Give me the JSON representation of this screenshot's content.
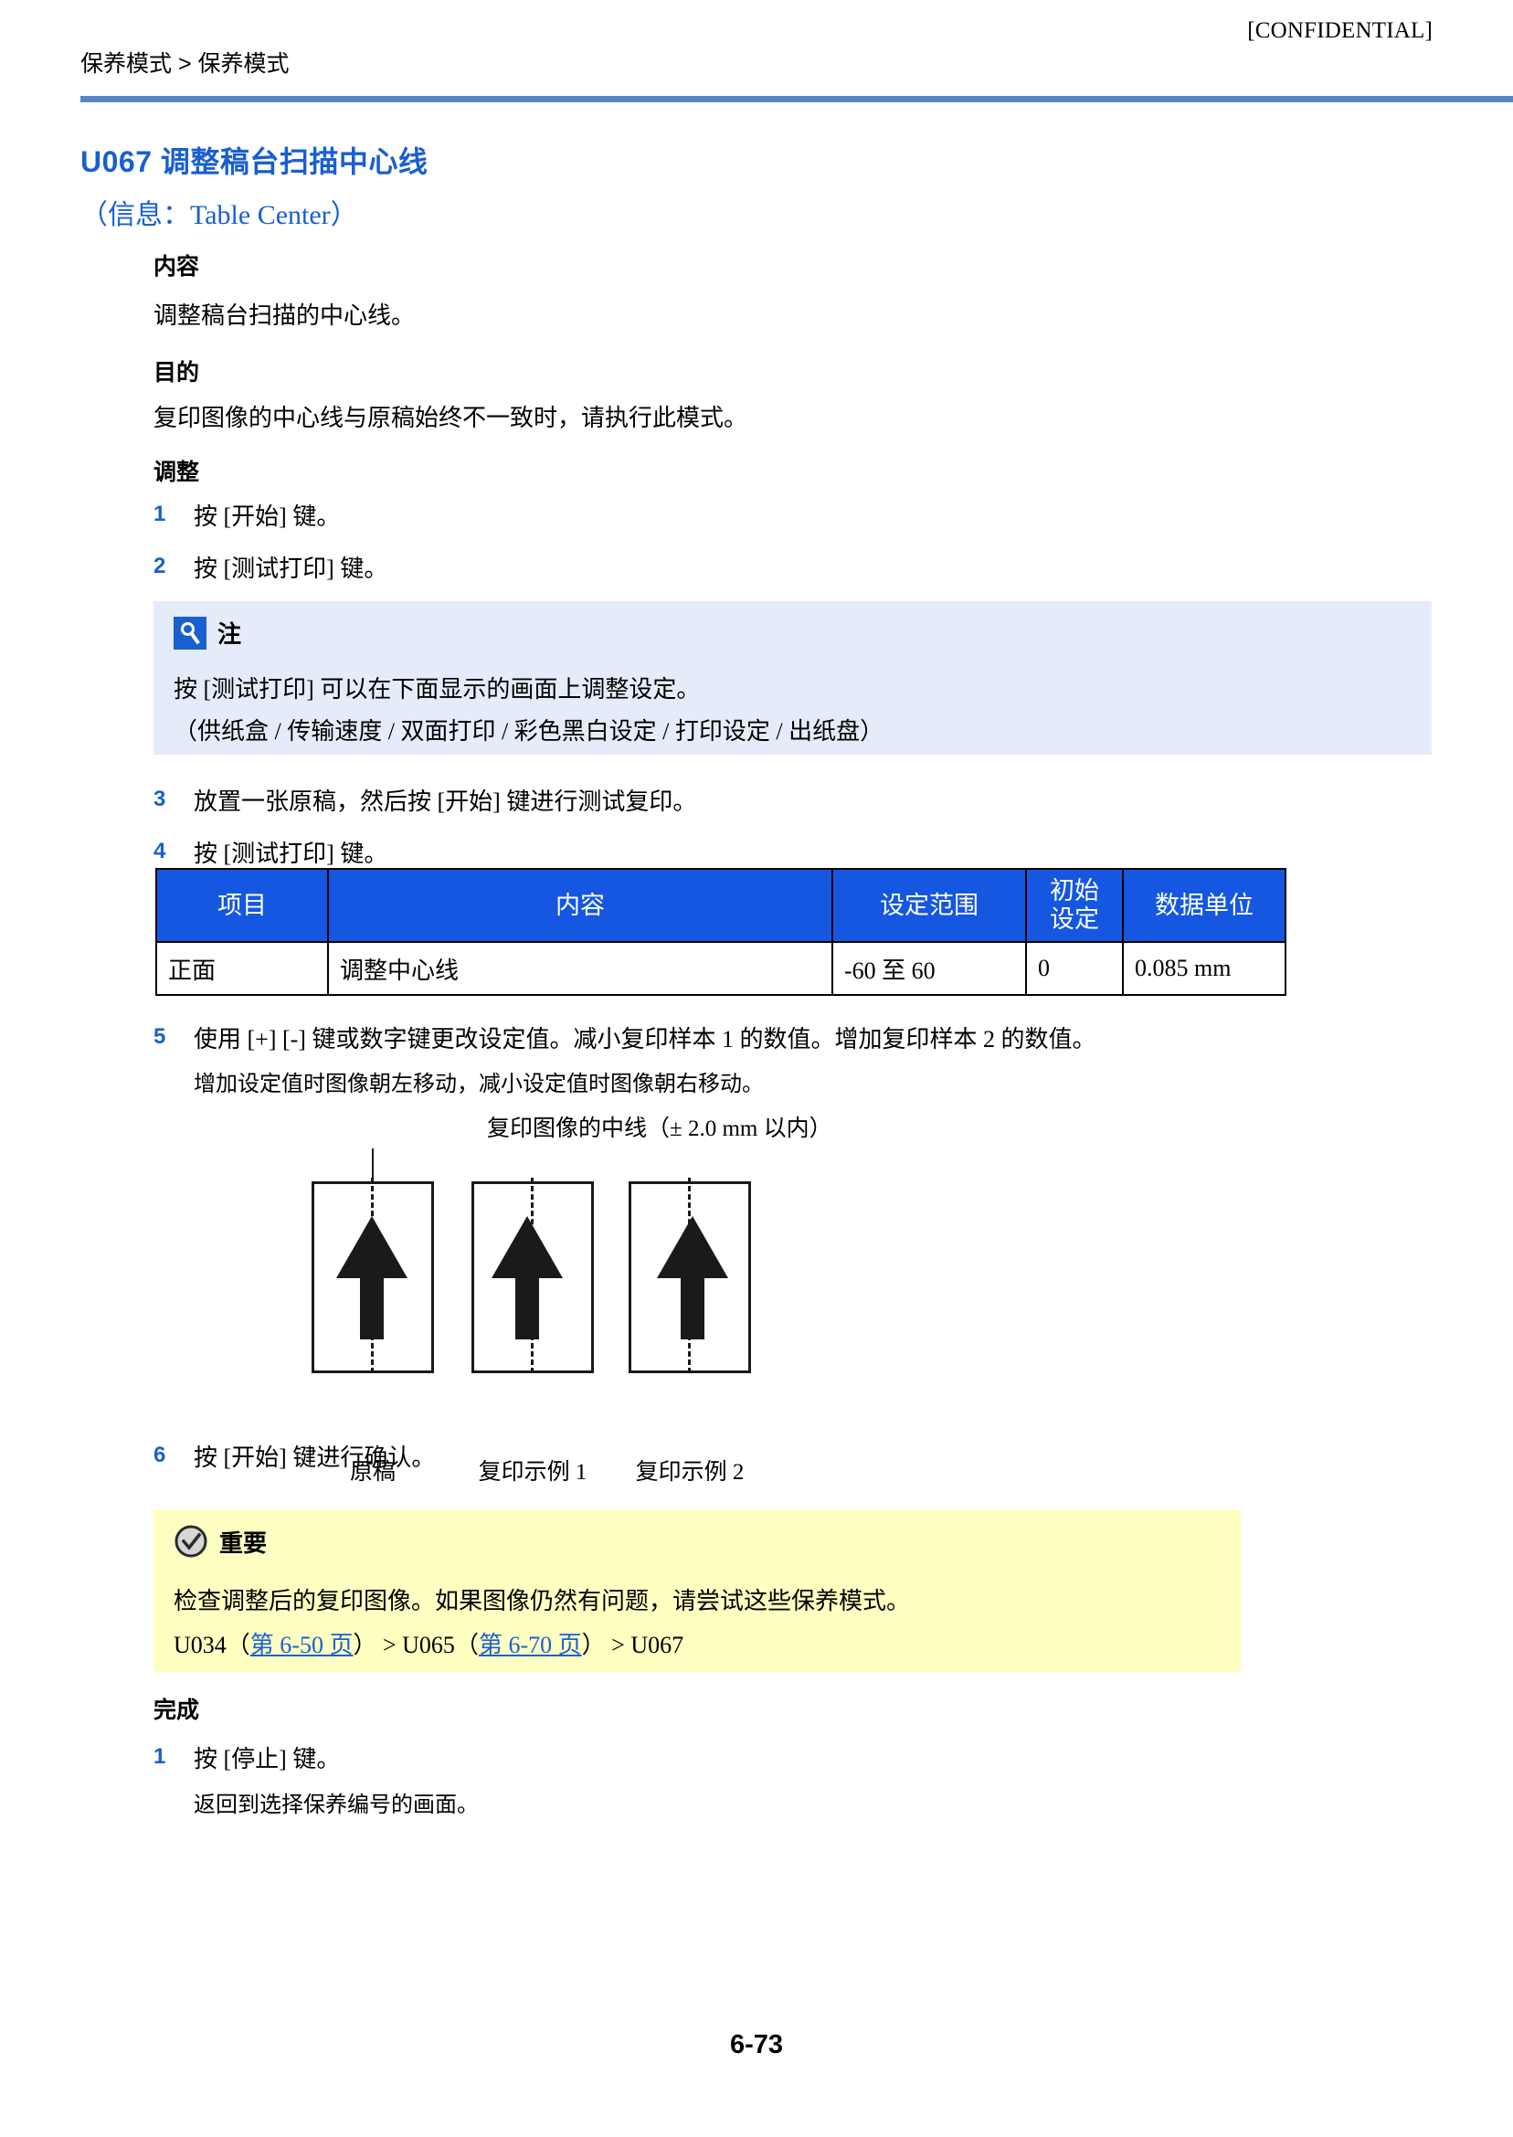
{
  "header": {
    "breadcrumb": "保养模式 > 保养模式",
    "confidential": "[CONFIDENTIAL]"
  },
  "title": "U067 调整稿台扫描中心线",
  "subtitle": "（信息：Table Center）",
  "sections": {
    "description_head": "内容",
    "description_text": "调整稿台扫描的中心线。",
    "purpose_head": "目的",
    "purpose_text": "复印图像的中心线与原稿始终不一致时，请执行此模式。",
    "adjust_head": "调整",
    "complete_head": "完成"
  },
  "adjust_steps": [
    {
      "num": "1",
      "text": "按 [开始] 键。"
    },
    {
      "num": "2",
      "text": "按 [测试打印] 键。"
    },
    {
      "num": "3",
      "text": "放置一张原稿，然后按 [开始] 键进行测试复印。"
    },
    {
      "num": "4",
      "text": "按 [测试打印] 键。"
    },
    {
      "num": "5",
      "text": "使用 [+] [-] 键或数字键更改设定值。减小复印样本 1 的数值。增加复印样本 2 的数值。",
      "sub": "增加设定值时图像朝左移动，减小设定值时图像朝右移动。"
    },
    {
      "num": "6",
      "text": "按 [开始] 键进行确认。"
    }
  ],
  "complete_steps": [
    {
      "num": "1",
      "text": "按 [停止] 键。",
      "sub": "返回到选择保养编号的画面。"
    }
  ],
  "note": {
    "icon": "note-pen-icon",
    "title": "注",
    "line1": "按 [测试打印] 可以在下面显示的画面上调整设定。",
    "line2": "（供纸盒 / 传输速度 / 双面打印 / 彩色黑白设定 / 打印设定 / 出纸盘）",
    "background_color": "#e4ecf9",
    "icon_color": "#1a5fd0"
  },
  "important": {
    "icon": "check-circle-icon",
    "title": "重要",
    "line1": "检查调整后的复印图像。如果图像仍然有问题，请尝试这些保养模式。",
    "xref": {
      "part1": "U034",
      "link1_open": "（",
      "link1": "第 6-50 页",
      "link1_close": "）",
      "sep1": " > ",
      "part2": "U065",
      "link2_open": "（",
      "link2": "第 6-70 页",
      "link2_close": "）",
      "sep2": " > ",
      "part3": "U067"
    },
    "background_color": "#ffffc2"
  },
  "table": {
    "header_color": "#1557e0",
    "columns": [
      "项目",
      "内容",
      "设定范围",
      "初始\n设定",
      "数据单位"
    ],
    "columns_display": {
      "item": "项目",
      "content": "内容",
      "range": "设定范围",
      "initial_line1": "初始",
      "initial_line2": "设定",
      "unit": "数据单位"
    },
    "rows": [
      {
        "item": "正面",
        "content": "调整中心线",
        "range": "-60 至 60",
        "initial": "0",
        "unit": "0.085 mm"
      }
    ]
  },
  "diagram": {
    "caption": "复印图像的中线（± 2.0 mm 以内）",
    "figures": [
      {
        "label": "原稿"
      },
      {
        "label": "复印示例 1"
      },
      {
        "label": "复印示例 2"
      }
    ]
  },
  "footer": {
    "page_number": "6-73"
  }
}
